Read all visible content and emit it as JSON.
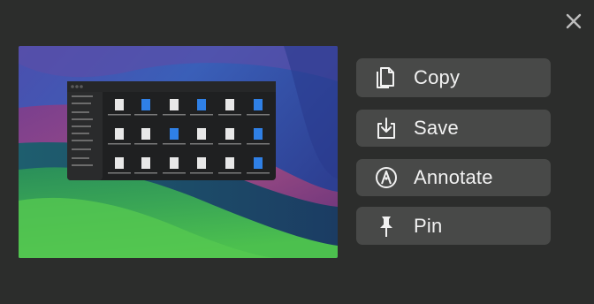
{
  "close": {
    "icon": "close-icon"
  },
  "preview": {
    "description_icon": "screenshot-thumbnail"
  },
  "actions": [
    {
      "id": "copy",
      "label": "Copy",
      "icon": "copy-icon"
    },
    {
      "id": "save",
      "label": "Save",
      "icon": "save-download-icon"
    },
    {
      "id": "annotate",
      "label": "Annotate",
      "icon": "pen-tip-icon"
    },
    {
      "id": "pin",
      "label": "Pin",
      "icon": "pin-icon"
    }
  ],
  "colors": {
    "background": "#2c2d2c",
    "button": "#484948",
    "text": "#f2f2f2",
    "accent_blue": "#2f80e6"
  }
}
